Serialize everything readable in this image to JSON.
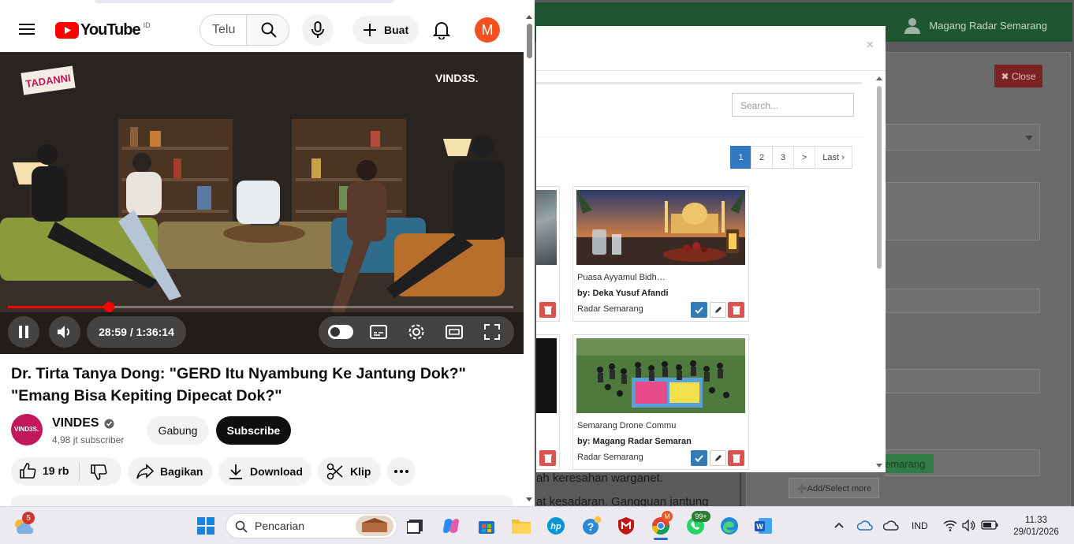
{
  "admin": {
    "user_name": "Magang Radar Semarang",
    "close_label": "✖ Close",
    "add_select_label": "➕Add/Select more",
    "tag_label": "emarang",
    "article_line1": "ah keresahan warganet.",
    "article_line2": "at kesadaran. Gangguan jantung"
  },
  "modal": {
    "close_symbol": "×",
    "search_placeholder": "Search...",
    "pagination": [
      "1",
      "2",
      "3",
      ">",
      "Last ›"
    ],
    "active_page": "1",
    "cards": [
      {
        "title": "Puasa Ayyamul Bidh…",
        "author": "by: Deka Yusuf Afandi",
        "publisher": "Radar Semarang"
      },
      {
        "title": "Semarang Drone Commu",
        "author": "by: Magang Radar Semaran",
        "publisher": "Radar Semarang"
      }
    ]
  },
  "youtube": {
    "logo_text": "YouTube",
    "region": "ID",
    "search_value": "Telu",
    "create_label": "Buat",
    "avatar_letter": "M",
    "video": {
      "watermark_left": "TADANNI",
      "watermark_right": "VIND3S.",
      "time_current": "28:59",
      "time_total": "1:36:14",
      "time_display": "28:59 / 1:36:14",
      "progress_fraction": 0.2
    },
    "title": "Dr. Tirta Tanya Dong: \"GERD Itu Nyambung Ke Jantung Dok?\" \"Emang Bisa Kepiting Dipecat Dok?\"",
    "channel": {
      "name": "VINDES",
      "avatar_text": "VIND3S.",
      "subscribers": "4,98 jt subscriber",
      "join_label": "Gabung",
      "subscribe_label": "Subscribe"
    },
    "actions": {
      "likes": "19 rb",
      "share": "Bagikan",
      "download": "Download",
      "clip": "Klip"
    }
  },
  "taskbar": {
    "search_placeholder": "Pencarian",
    "weather_badge": "5",
    "whatsapp_badge": "99+",
    "chrome_badge": "M",
    "language": "IND",
    "time": "11.33",
    "date": "29/01/2026"
  }
}
